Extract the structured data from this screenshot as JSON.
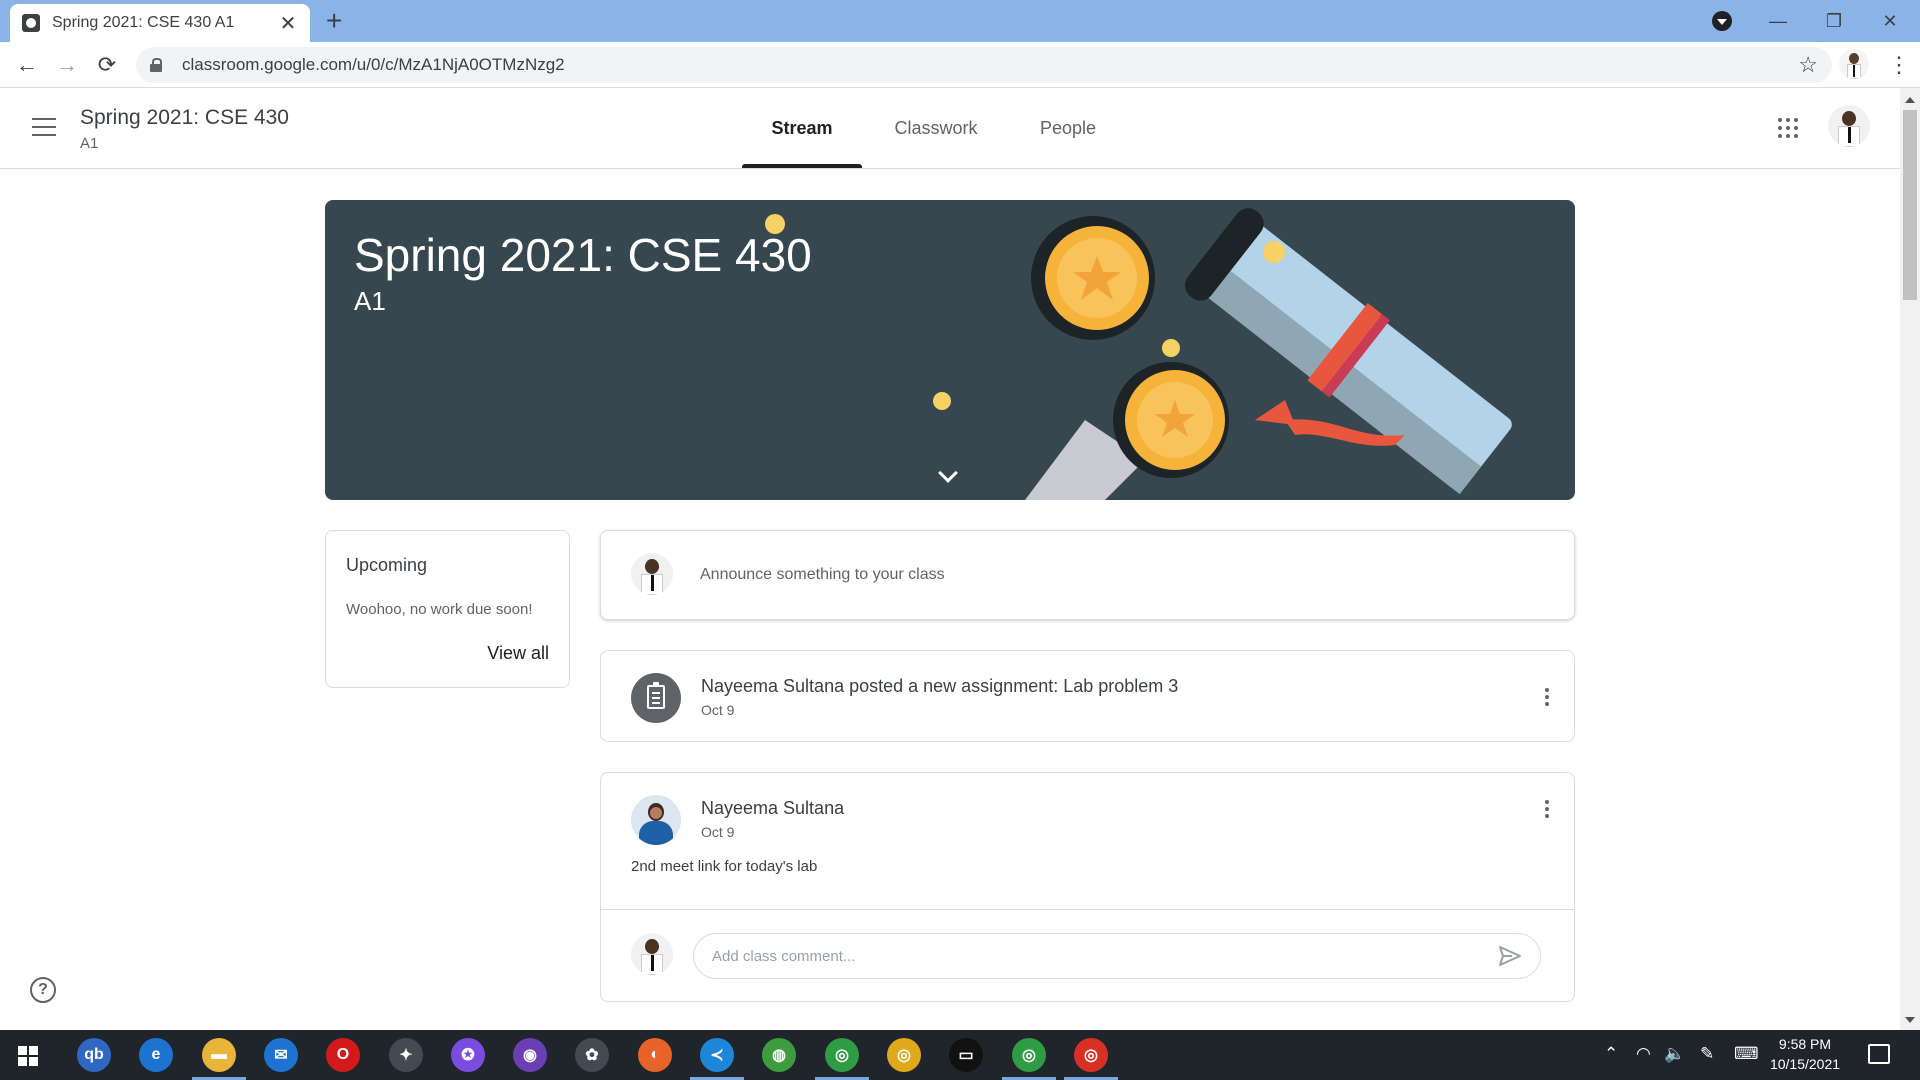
{
  "browser": {
    "tab_title": "Spring 2021: CSE 430 A1",
    "tab_close": "✕",
    "new_tab": "+",
    "url": "classroom.google.com/u/0/c/MzA1NjA0OTMzNzg2",
    "window_controls": {
      "minimize": "—",
      "maximize": "❐",
      "close": "✕"
    },
    "back": "←",
    "forward": "→",
    "reload": "⟳",
    "star": "☆",
    "menu": "⋮"
  },
  "header": {
    "class_title": "Spring 2021: CSE 430",
    "class_section": "A1",
    "tabs": [
      {
        "label": "Stream",
        "active": true
      },
      {
        "label": "Classwork",
        "active": false
      },
      {
        "label": "People",
        "active": false
      }
    ]
  },
  "banner": {
    "title": "Spring 2021: CSE 430",
    "section": "A1"
  },
  "upcoming": {
    "heading": "Upcoming",
    "message": "Woohoo, no work due soon!",
    "view_all": "View all"
  },
  "announce": {
    "placeholder": "Announce something to your class"
  },
  "stream": {
    "assignment": {
      "text": "Nayeema Sultana posted a new assignment: Lab problem 3",
      "date": "Oct 9"
    },
    "post": {
      "author": "Nayeema Sultana",
      "date": "Oct 9",
      "body": "2nd meet link for today's lab",
      "comment_placeholder": "Add class comment..."
    }
  },
  "help": "?",
  "taskbar": {
    "time": "9:58 PM",
    "date": "10/15/2021",
    "apps": [
      {
        "name": "qbittorrent",
        "glyph": "qb",
        "color": "#2f67c2"
      },
      {
        "name": "edge-legacy",
        "glyph": "e",
        "color": "#1e73d1"
      },
      {
        "name": "file-explorer",
        "glyph": "▬",
        "color": "#e8b43a"
      },
      {
        "name": "mail",
        "glyph": "✉",
        "color": "#1e73d1"
      },
      {
        "name": "opera",
        "glyph": "O",
        "color": "#d21a1a"
      },
      {
        "name": "satellite",
        "glyph": "✦",
        "color": "#444a52"
      },
      {
        "name": "messenger",
        "glyph": "✪",
        "color": "#7a4ce0"
      },
      {
        "name": "github",
        "glyph": "◉",
        "color": "#6a3fb5"
      },
      {
        "name": "paint",
        "glyph": "✿",
        "color": "#444a52"
      },
      {
        "name": "firefox",
        "glyph": "◐",
        "color": "#e8632a"
      },
      {
        "name": "vscode",
        "glyph": "≺",
        "color": "#1e86d8"
      },
      {
        "name": "app-globe",
        "glyph": "◍",
        "color": "#3e9b40"
      },
      {
        "name": "chrome-1",
        "glyph": "◎",
        "color": "#2f9b45"
      },
      {
        "name": "chrome-2",
        "glyph": "◎",
        "color": "#e0a91c"
      },
      {
        "name": "terminal",
        "glyph": "▭",
        "color": "#111"
      },
      {
        "name": "chrome-ek",
        "glyph": "◎",
        "color": "#2f9b45"
      },
      {
        "name": "chrome-active",
        "glyph": "◎",
        "color": "#d93025"
      }
    ]
  }
}
